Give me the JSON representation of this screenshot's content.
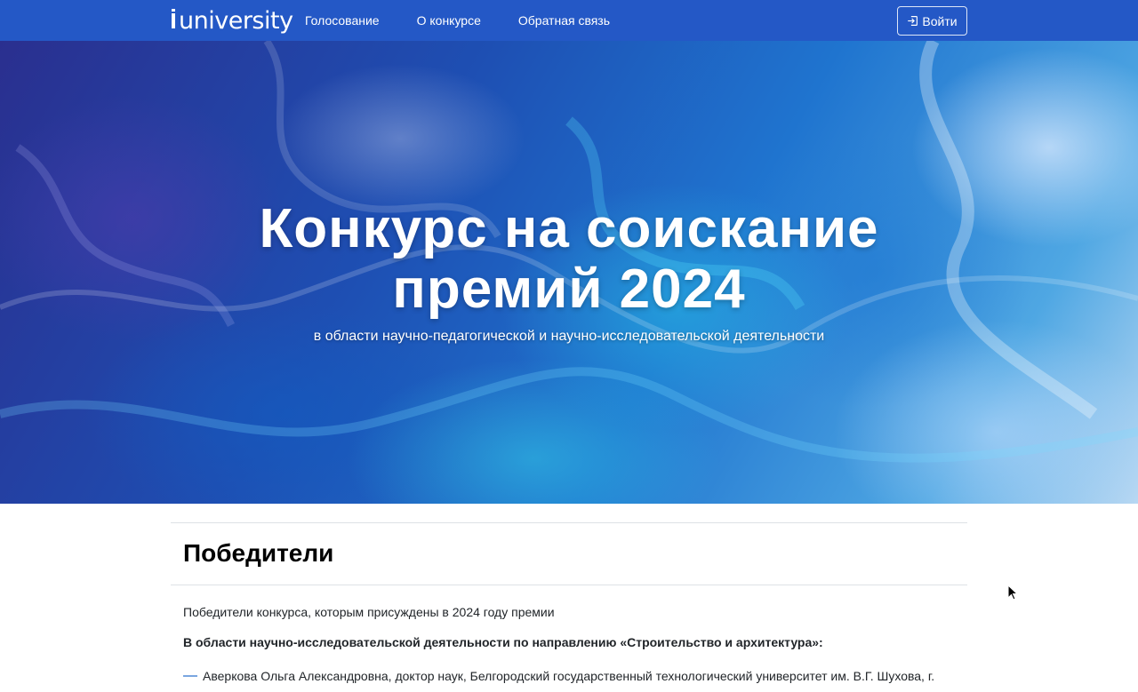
{
  "navbar": {
    "brand": "university",
    "links": [
      "Голосование",
      "О конкурсе",
      "Обратная связь"
    ],
    "login_label": "Войти"
  },
  "hero": {
    "title_line1": "Конкурс на соискание",
    "title_line2": "премий 2024",
    "subtitle": "в области научно-педагогической и научно-исследовательской деятельности"
  },
  "content": {
    "heading": "Победители",
    "intro": "Победители конкурса, которым присуждены в 2024 году премии",
    "section_title": "В области научно-исследовательской деятельности по направлению «Строительство и архитектура»:",
    "winners": [
      "Аверкова Ольга Александровна, доктор наук, Белгородский государственный технологический университет им. В.Г. Шухова, г."
    ]
  },
  "colors": {
    "navbar": "#2458c6",
    "dash": "#7aa6e0"
  }
}
